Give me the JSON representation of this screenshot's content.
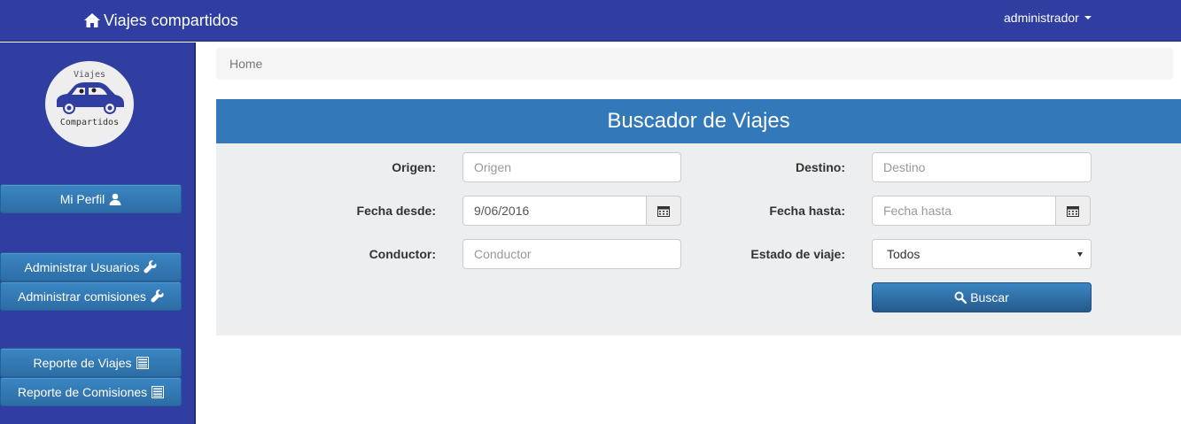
{
  "navbar": {
    "brand": "Viajes compartidos",
    "brand_icon": "home-icon",
    "user": "administrador"
  },
  "sidebar": {
    "logo": {
      "top_text": "Viajes",
      "bottom_text": "Compartidos"
    },
    "items": [
      {
        "label": "Mi Perfil",
        "icon": "user-icon"
      },
      {
        "label": "Administrar Usuarios",
        "icon": "wrench-icon"
      },
      {
        "label": "Administrar comisiones",
        "icon": "wrench-icon"
      },
      {
        "label": "Reporte de Viajes",
        "icon": "list-icon"
      },
      {
        "label": "Reporte de Comisiones",
        "icon": "list-icon"
      }
    ]
  },
  "breadcrumb": {
    "current": "Home"
  },
  "panel": {
    "title": "Buscador de Viajes",
    "fields": {
      "origen": {
        "label": "Origen:",
        "placeholder": "Origen",
        "value": ""
      },
      "destino": {
        "label": "Destino:",
        "placeholder": "Destino",
        "value": ""
      },
      "fecha_desde": {
        "label": "Fecha desde:",
        "placeholder": "",
        "value": "9/06/2016"
      },
      "fecha_hasta": {
        "label": "Fecha hasta:",
        "placeholder": "Fecha hasta",
        "value": ""
      },
      "conductor": {
        "label": "Conductor:",
        "placeholder": "Conductor",
        "value": ""
      },
      "estado": {
        "label": "Estado de viaje:",
        "selected": "Todos"
      }
    },
    "search_button": "Buscar"
  },
  "colors": {
    "navbar": "#2f3ea0",
    "button": "#3378b8",
    "panel_header": "#3378b8",
    "panel_body": "#eceeef"
  }
}
